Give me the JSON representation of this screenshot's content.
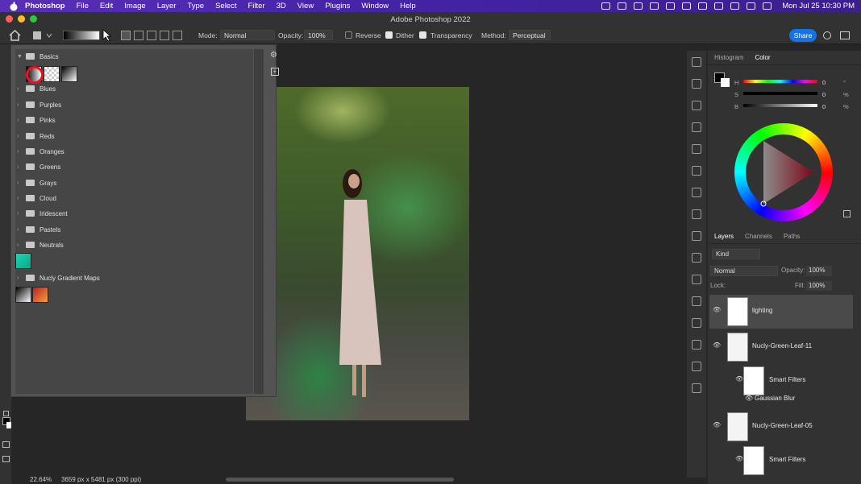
{
  "menubar": {
    "app_name": "Photoshop",
    "items": [
      "File",
      "Edit",
      "Image",
      "Layer",
      "Type",
      "Select",
      "Filter",
      "3D",
      "View",
      "Plugins",
      "Window",
      "Help"
    ],
    "clock": "Mon Jul 25  10:30 PM"
  },
  "titlebar": {
    "title": "Adobe Photoshop 2022"
  },
  "options": {
    "mode_label": "Mode:",
    "mode_value": "Normal",
    "opacity_label": "Opacity:",
    "opacity_value": "100%",
    "reverse_label": "Reverse",
    "dither_label": "Dither",
    "transparency_label": "Transparency",
    "method_label": "Method:",
    "method_value": "Perceptual",
    "share_label": "Share"
  },
  "gradients": {
    "folders": [
      "Basics",
      "Blues",
      "Purples",
      "Pinks",
      "Reds",
      "Oranges",
      "Greens",
      "Grays",
      "Cloud",
      "Iridescent",
      "Pastels",
      "Neutrals",
      "Nucly Gradient Maps"
    ]
  },
  "color_panel": {
    "tabs": [
      "Histogram",
      "Color"
    ],
    "h_label": "H",
    "h_value": "0",
    "h_unit": "°",
    "s_label": "S",
    "s_value": "0",
    "s_unit": "%",
    "b_label": "B",
    "b_value": "0",
    "b_unit": "%"
  },
  "layers_panel": {
    "tabs": [
      "Layers",
      "Channels",
      "Paths"
    ],
    "kind_label": "Kind",
    "blend_mode": "Normal",
    "opacity_label": "Opacity:",
    "opacity_value": "100%",
    "lock_label": "Lock:",
    "fill_label": "Fill:",
    "fill_value": "100%",
    "layers": [
      {
        "name": "lighting"
      },
      {
        "name": "Nucly-Green-Leaf-11"
      },
      {
        "name": "Smart Filters"
      },
      {
        "name": "Gaussian Blur"
      },
      {
        "name": "Nucly-Green-Leaf-05"
      },
      {
        "name": "Smart Filters"
      }
    ]
  },
  "status": {
    "zoom": "22.64%",
    "doc_info": "3659 px x 5481 px (300 ppi)"
  }
}
